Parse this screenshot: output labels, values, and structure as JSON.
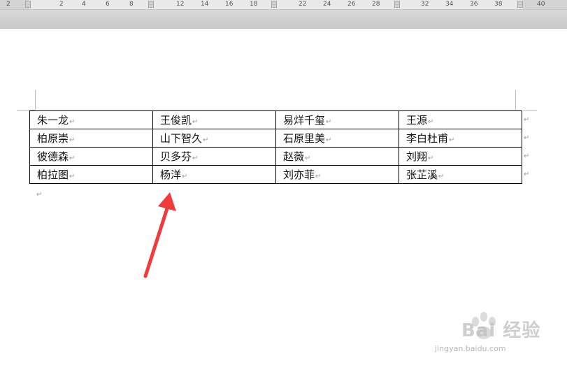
{
  "ruler": {
    "numbers": [
      "2",
      "2",
      "4",
      "6",
      "8",
      "12",
      "14",
      "16",
      "18",
      "22",
      "24",
      "26",
      "28",
      "32",
      "34",
      "36",
      "38",
      "40"
    ]
  },
  "table": {
    "rows": [
      [
        "朱一龙",
        "王俊凯",
        "易烊千玺",
        "王源"
      ],
      [
        "柏原崇",
        "山下智久",
        "石原里美",
        "李白杜甫"
      ],
      [
        "彼德森",
        "贝多芬",
        "赵薇",
        "刘翔"
      ],
      [
        "柏拉图",
        "杨洋",
        "刘亦菲",
        "张芷溪"
      ]
    ],
    "cell_mark": "↵"
  },
  "annotation": {
    "arrow_color": "#ef3b3b"
  },
  "watermark": {
    "brand": "Bai 经验",
    "url": "jingyan.baidu.com"
  }
}
